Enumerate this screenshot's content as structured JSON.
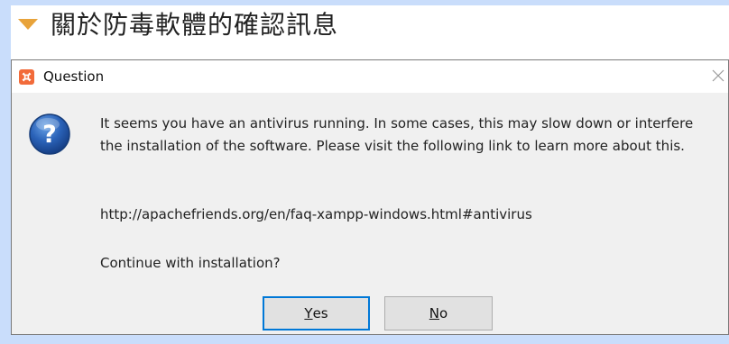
{
  "heading": {
    "title": "關於防毒軟體的確認訊息",
    "expander_icon": "triangle-down-icon"
  },
  "dialog": {
    "title": "Question",
    "app_icon": "xampp-icon",
    "question_icon": "question-icon",
    "message": "It seems you have an antivirus running. In some cases, this may slow down or interfere the installation of the software. Please visit the following link to learn more about this.",
    "link": "http://apachefriends.org/en/faq-xampp-windows.html#antivirus",
    "prompt": "Continue with installation?",
    "buttons": {
      "yes_mnemonic": "Y",
      "yes_rest": "es",
      "no_mnemonic": "N",
      "no_rest": "o"
    }
  },
  "colors": {
    "accent": "#e8a33a",
    "frame": "#c9ddfb",
    "focus_border": "#0078d7",
    "app_icon": "#f26b3a"
  }
}
